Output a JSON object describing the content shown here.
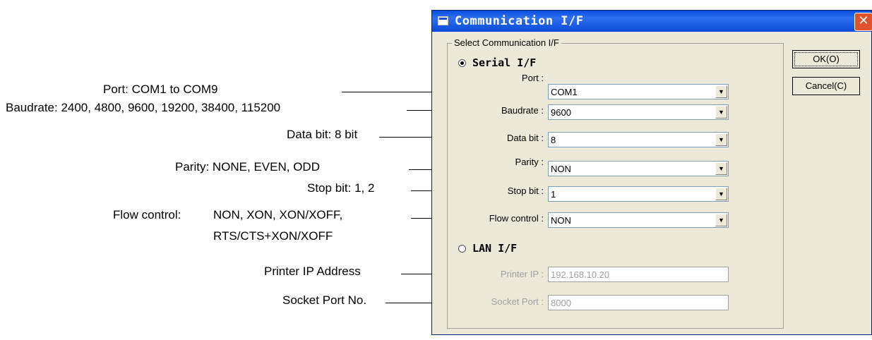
{
  "annotations": {
    "port": "Port: COM1 to COM9",
    "baudrate": "Baudrate: 2400, 4800, 9600, 19200, 38400, 115200",
    "databit": "Data bit: 8 bit",
    "parity": "Parity: NONE, EVEN, ODD",
    "stopbit": "Stop bit: 1, 2",
    "flow_prefix": "Flow control:",
    "flow_line1": "NON, XON, XON/XOFF,",
    "flow_line2": "RTS/CTS+XON/XOFF",
    "printer_ip": "Printer IP Address",
    "socket_port": "Socket Port No."
  },
  "dialog": {
    "title": "Communication I/F",
    "close_glyph": "✕",
    "group_label": "Select Communication I/F",
    "serial": {
      "label": "Serial I/F",
      "selected": true,
      "fields": [
        {
          "label": "Port :",
          "value": "COM1"
        },
        {
          "label": "Baudrate :",
          "value": "9600"
        },
        {
          "label": "Data bit :",
          "value": "8"
        },
        {
          "label": "Parity :",
          "value": "NON"
        },
        {
          "label": "Stop bit :",
          "value": "1"
        },
        {
          "label": "Flow control :",
          "value": "NON"
        }
      ]
    },
    "lan": {
      "label": "LAN I/F",
      "selected": false,
      "fields": [
        {
          "label": "Printer IP :",
          "value": "192.168.10.20"
        },
        {
          "label": "Socket Port :",
          "value": "8000"
        }
      ]
    },
    "buttons": {
      "ok": "OK(O)",
      "cancel": "Cancel(C)"
    },
    "dropdown_arrow": "▼"
  }
}
